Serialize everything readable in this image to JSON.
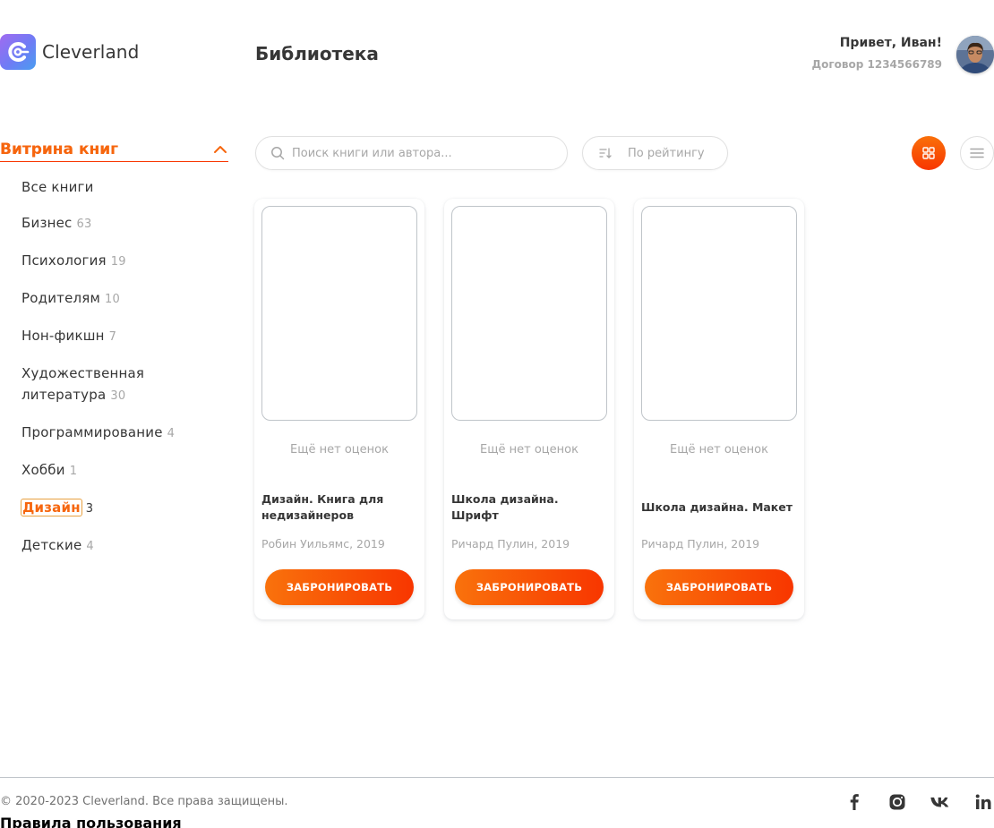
{
  "header": {
    "logo_text": "Cleverland",
    "page_title": "Библиотека",
    "greeting": "Привет, Иван!",
    "contract": "Договор 1234566789"
  },
  "sidebar": {
    "section_title": "Витрина книг",
    "categories": [
      {
        "label": "Все книги",
        "count": ""
      },
      {
        "label": "Бизнес",
        "count": "63"
      },
      {
        "label": "Психология",
        "count": "19"
      },
      {
        "label": "Родителям",
        "count": "10"
      },
      {
        "label": "Нон-фикшн",
        "count": "7"
      },
      {
        "label": "Художественная литература",
        "count": "30"
      },
      {
        "label": "Программирование",
        "count": "4"
      },
      {
        "label": "Хобби",
        "count": "1"
      },
      {
        "label": "Дизайн",
        "count": "3"
      },
      {
        "label": "Детские",
        "count": "4"
      }
    ]
  },
  "toolbar": {
    "search_placeholder": "Поиск книги или автора...",
    "sort_label": "По рейтингу"
  },
  "books": [
    {
      "rating": "Ещё нет оценок",
      "title": "Дизайн. Книга для недизайнеров",
      "author": "Робин Уильямс, 2019",
      "button": "ЗАБРОНИРОВАТЬ"
    },
    {
      "rating": "Ещё нет оценок",
      "title": "Школа дизайна. Шрифт",
      "author": "Ричард Пулин, 2019",
      "button": "ЗАБРОНИРОВАТЬ"
    },
    {
      "rating": "Ещё нет оценок",
      "title": "Школа дизайна. Макет",
      "author": "Ричард Пулин, 2019",
      "button": "ЗАБРОНИРОВАТЬ"
    }
  ],
  "footer": {
    "copyright": "© 2020-2023 Cleverland. Все права защищены.",
    "rules": "Правила пользования"
  },
  "icons": {
    "logo": "logo-c-icon",
    "search": "search-icon",
    "sort": "sort-icon",
    "grid": "grid-view-icon",
    "list": "list-view-icon",
    "chevron": "chevron-up-icon",
    "socials": [
      "facebook-icon",
      "instagram-icon",
      "vk-icon",
      "linkedin-icon"
    ]
  },
  "colors": {
    "accent": "#f83600",
    "accent_light": "#f9720c",
    "text": "#363636",
    "muted": "#a7a7a7"
  }
}
